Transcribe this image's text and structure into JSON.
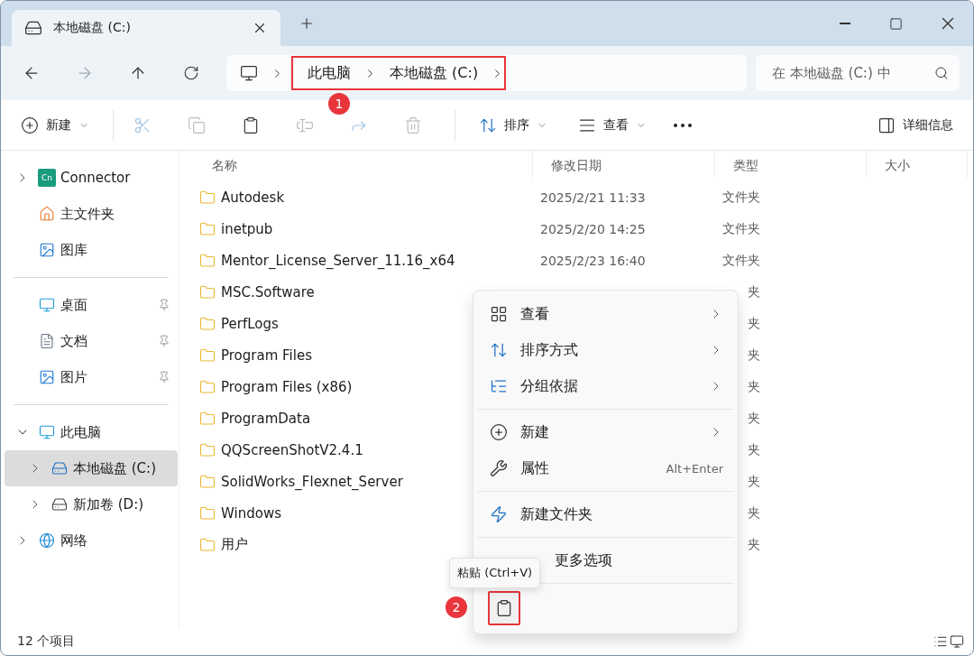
{
  "window": {
    "tab_title": "本地磁盘 (C:)"
  },
  "address_bar": {
    "crumbs": [
      {
        "label": "此电脑"
      },
      {
        "label": "本地磁盘 (C:)"
      }
    ],
    "annotation": "1"
  },
  "search": {
    "placeholder": "在 本地磁盘 (C:) 中"
  },
  "toolbar": {
    "items": [
      {
        "kind": "new",
        "label": "新建",
        "disabled": false
      },
      {
        "kind": "cut",
        "disabled": true
      },
      {
        "kind": "copy",
        "disabled": true
      },
      {
        "kind": "paste",
        "disabled": false
      },
      {
        "kind": "rename",
        "disabled": true
      },
      {
        "kind": "share",
        "disabled": true
      },
      {
        "kind": "delete",
        "disabled": true
      },
      {
        "kind": "sort",
        "label": "排序",
        "disabled": false
      },
      {
        "kind": "view",
        "label": "查看",
        "disabled": false
      },
      {
        "kind": "more",
        "disabled": false
      }
    ],
    "details": "详细信息"
  },
  "sidebar": {
    "groups": [
      [
        {
          "kind": "connector",
          "logo_text": "Cn",
          "label": "Connector",
          "expandable": true,
          "expanded": false,
          "selected": false
        },
        {
          "kind": "home",
          "label": "主文件夹",
          "expandable": false,
          "selected": false
        },
        {
          "kind": "gallery",
          "label": "图库",
          "expandable": false,
          "selected": false
        }
      ],
      [
        {
          "kind": "desktop",
          "label": "桌面",
          "pinned": true,
          "expandable": false,
          "selected": false
        },
        {
          "kind": "documents",
          "label": "文档",
          "pinned": true,
          "expandable": false,
          "selected": false
        },
        {
          "kind": "pictures",
          "label": "图片",
          "pinned": true,
          "expandable": false,
          "selected": false
        }
      ],
      [
        {
          "kind": "pc",
          "label": "此电脑",
          "expandable": true,
          "expanded": true,
          "selected": false,
          "children": [
            {
              "kind": "system-drive",
              "label": "本地磁盘 (C:)",
              "expandable": true,
              "expanded": false,
              "selected": true
            },
            {
              "kind": "drive",
              "label": "新加卷 (D:)",
              "expandable": true,
              "expanded": false,
              "selected": false
            }
          ]
        },
        {
          "kind": "network",
          "label": "网络",
          "expandable": true,
          "expanded": false,
          "selected": false
        }
      ]
    ]
  },
  "table": {
    "columns": [
      "名称",
      "修改日期",
      "类型",
      "大小"
    ],
    "rows": [
      {
        "name": "Autodesk",
        "modified": "2025/2/21 11:33",
        "type": "文件夹"
      },
      {
        "name": "inetpub",
        "modified": "2025/2/20 14:25",
        "type": "文件夹"
      },
      {
        "name": "Mentor_License_Server_11.16_x64",
        "modified": "2025/2/23 16:40",
        "type": "文件夹"
      },
      {
        "name": "MSC.Software",
        "type": "夹"
      },
      {
        "name": "PerfLogs",
        "type": "夹"
      },
      {
        "name": "Program Files",
        "type": "夹"
      },
      {
        "name": "Program Files (x86)",
        "type": "夹"
      },
      {
        "name": "ProgramData",
        "type": "夹"
      },
      {
        "name": "QQScreenShotV2.4.1",
        "type": "夹"
      },
      {
        "name": "SolidWorks_Flexnet_Server",
        "type": "夹"
      },
      {
        "name": "Windows",
        "type": "夹"
      },
      {
        "name": "用户",
        "type": "夹"
      }
    ]
  },
  "context_menu": {
    "groups": [
      [
        {
          "kind": "view",
          "label": "查看",
          "submenu": true
        },
        {
          "kind": "sort",
          "label": "排序方式",
          "submenu": true
        },
        {
          "kind": "group",
          "label": "分组依据",
          "submenu": true
        }
      ],
      [
        {
          "kind": "new",
          "label": "新建",
          "submenu": true
        },
        {
          "kind": "properties",
          "label": "属性",
          "shortcut": "Alt+Enter",
          "submenu": false
        }
      ],
      [
        {
          "kind": "new-folder",
          "label": "新建文件夹",
          "submenu": false
        }
      ],
      [
        {
          "kind": "more",
          "label": "更多选项",
          "submenu": false
        }
      ]
    ],
    "actions": [
      {
        "kind": "paste",
        "tooltip": "粘贴 (Ctrl+V)",
        "annotation": "2"
      }
    ]
  },
  "status_bar": {
    "count": "12 个项目"
  }
}
